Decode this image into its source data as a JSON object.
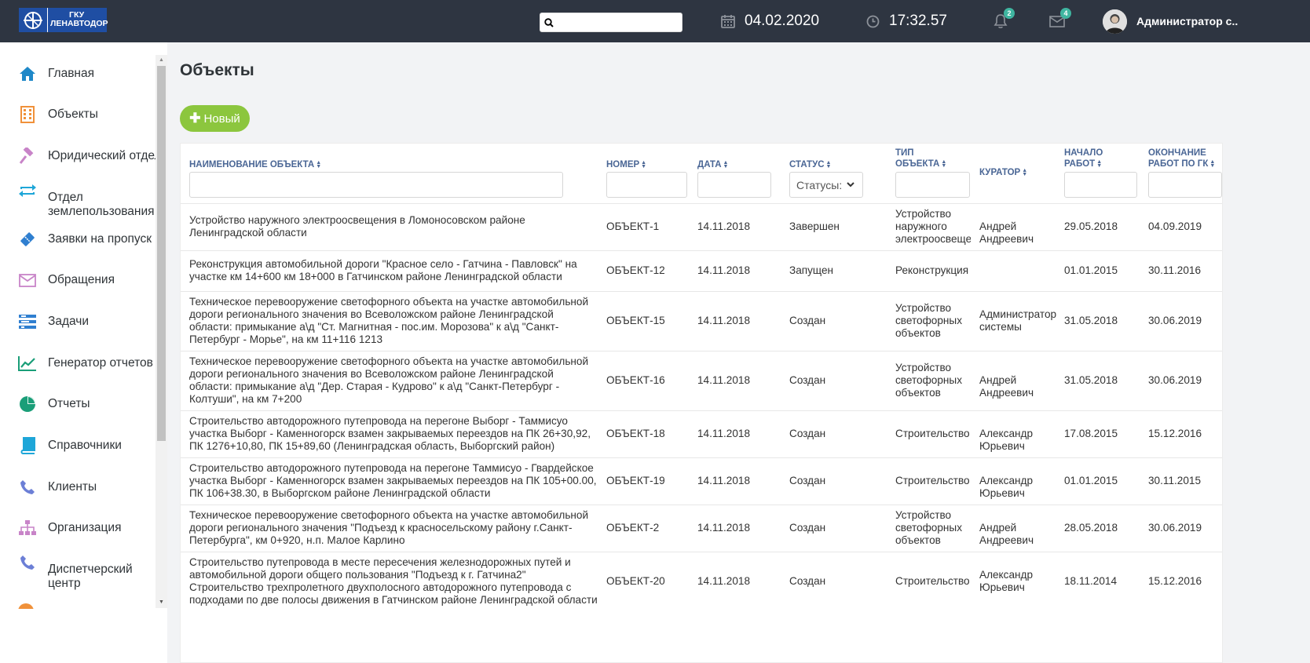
{
  "logo": {
    "line1": "ГКУ",
    "line2": "ЛЕНАВТОДОР"
  },
  "search": {
    "value": ""
  },
  "header": {
    "date": "04.02.2020",
    "time": "17:32.57",
    "notifications_count": "2",
    "messages_count": "4",
    "user": "Администратор с.."
  },
  "sidebar": {
    "items": [
      {
        "label": "Главная",
        "icon": "home-icon",
        "color": "#1e88c8"
      },
      {
        "label": "Объекты",
        "icon": "building-icon",
        "color": "#f0913a"
      },
      {
        "label": "Юридический отдел",
        "icon": "gavel-icon",
        "color": "#c884c8"
      },
      {
        "label": "Отдел землепользования",
        "icon": "exchange-icon",
        "color": "#1ea6d8"
      },
      {
        "label": "Заявки на пропуск",
        "icon": "ticket-icon",
        "color": "#2f7fd0"
      },
      {
        "label": "Обращения",
        "icon": "envelope-icon",
        "color": "#c884c8"
      },
      {
        "label": "Задачи",
        "icon": "tasks-icon",
        "color": "#2f7fd0"
      },
      {
        "label": "Генератор отчетов",
        "icon": "chart-line-icon",
        "color": "#1a9e78"
      },
      {
        "label": "Отчеты",
        "icon": "pie-chart-icon",
        "color": "#1a9e78"
      },
      {
        "label": "Справочники",
        "icon": "book-icon",
        "color": "#1ea6d8"
      },
      {
        "label": "Клиенты",
        "icon": "phone-icon",
        "color": "#6c7fd6"
      },
      {
        "label": "Организация",
        "icon": "sitemap-icon",
        "color": "#c884c8"
      },
      {
        "label": "Диспетчерский центр",
        "icon": "phone-icon",
        "color": "#6c7fd6"
      }
    ]
  },
  "page": {
    "title": "Объекты",
    "new_button": "Новый"
  },
  "table": {
    "headers": {
      "name": "Наименование объекта",
      "number": "Номер",
      "date": "Дата",
      "status": "Статус",
      "type_line1": "Тип",
      "type_line2": "объекта",
      "curator": "Куратор",
      "start_line1": "Начало",
      "start_line2": "работ",
      "end_line1": "Окончание",
      "end_line2": "работ по ГК"
    },
    "status_filter": "Статусы:",
    "rows": [
      {
        "name": "Устройство наружного электроосвещения в Ломоносовском районе Ленинградской области",
        "number": "ОБЪЕКТ-1",
        "date": "14.11.2018",
        "status": "Завершен",
        "type": "Устройство наружного электроосвещения",
        "curator": "Андрей Андреевич",
        "start": "29.05.2018",
        "end": "04.09.2019"
      },
      {
        "name": "Реконструкция автомобильной дороги \"Красное село - Гатчина - Павловск\" на участке км 14+600 км 18+000 в Гатчинском районе Ленинградской области",
        "number": "ОБЪЕКТ-12",
        "date": "14.11.2018",
        "status": "Запущен",
        "type": "Реконструкция",
        "curator": "",
        "start": "01.01.2015",
        "end": "30.11.2016"
      },
      {
        "name": "Техническое перевооружение светофорного объекта на участке автомобильной дороги регионального значения во Всеволожском районе Ленинградской области: примыкание а\\д \"Ст. Магнитная - пос.им. Морозова\" к а\\д \"Санкт-Петербург - Морье\", на км 11+116 1213",
        "number": "ОБЪЕКТ-15",
        "date": "14.11.2018",
        "status": "Создан",
        "type": "Устройство светофорных объектов",
        "curator": "Администратор системы",
        "start": "31.05.2018",
        "end": "30.06.2019"
      },
      {
        "name": "Техническое перевооружение светофорного объекта на участке автомобильной дороги регионального значения во Всеволожском районе Ленинградской области: примыкание а\\д \"Дер. Старая - Кудрово\" к а\\д \"Санкт-Петербург - Колтуши\", на км 7+200",
        "number": "ОБЪЕКТ-16",
        "date": "14.11.2018",
        "status": "Создан",
        "type": "Устройство светофорных объектов",
        "curator": "Андрей Андреевич",
        "start": "31.05.2018",
        "end": "30.06.2019"
      },
      {
        "name": "Строительство автодорожного путепровода на перегоне Выборг - Таммисуо участка Выборг - Каменногорск взамен закрываемых переездов на ПК 26+30,92, ПК 1276+10,80, ПК 15+89,60 (Ленинградская область, Выборгский район)",
        "number": "ОБЪЕКТ-18",
        "date": "14.11.2018",
        "status": "Создан",
        "type": "Строительство",
        "curator": "Александр Юрьевич",
        "start": "17.08.2015",
        "end": "15.12.2016"
      },
      {
        "name": "Строительство автодорожного путепровода на перегоне Таммисуо - Гвардейское участка Выборг - Каменногорск взамен закрываемых переездов на ПК 105+00.00, ПК 106+38.30, в Выборгском районе Ленинградской области",
        "number": "ОБЪЕКТ-19",
        "date": "14.11.2018",
        "status": "Создан",
        "type": "Строительство",
        "curator": "Александр Юрьевич",
        "start": "01.01.2015",
        "end": "30.11.2015"
      },
      {
        "name": "Техническое перевооружение светофорного объекта на участке автомобильной дороги регионального значения \"Подъезд к красносельскому району г.Санкт-Петербурга\", км 0+920, н.п. Малое Карлино",
        "number": "ОБЪЕКТ-2",
        "date": "14.11.2018",
        "status": "Создан",
        "type": "Устройство светофорных объектов",
        "curator": "Андрей Андреевич",
        "start": "28.05.2018",
        "end": "30.06.2019"
      },
      {
        "name": "Строительство путепровода в месте пересечения железнодорожных путей и автомобильной дороги общего пользования \"Подъезд к г. Гатчина2\" Строительство трехпролетного двухполосного автодорожного путепровода с подходами по две полосы движения в Гатчинском районе Ленинградской области",
        "number": "ОБЪЕКТ-20",
        "date": "14.11.2018",
        "status": "Создан",
        "type": "Строительство",
        "curator": "Александр Юрьевич",
        "start": "18.11.2014",
        "end": "15.12.2016"
      }
    ]
  }
}
